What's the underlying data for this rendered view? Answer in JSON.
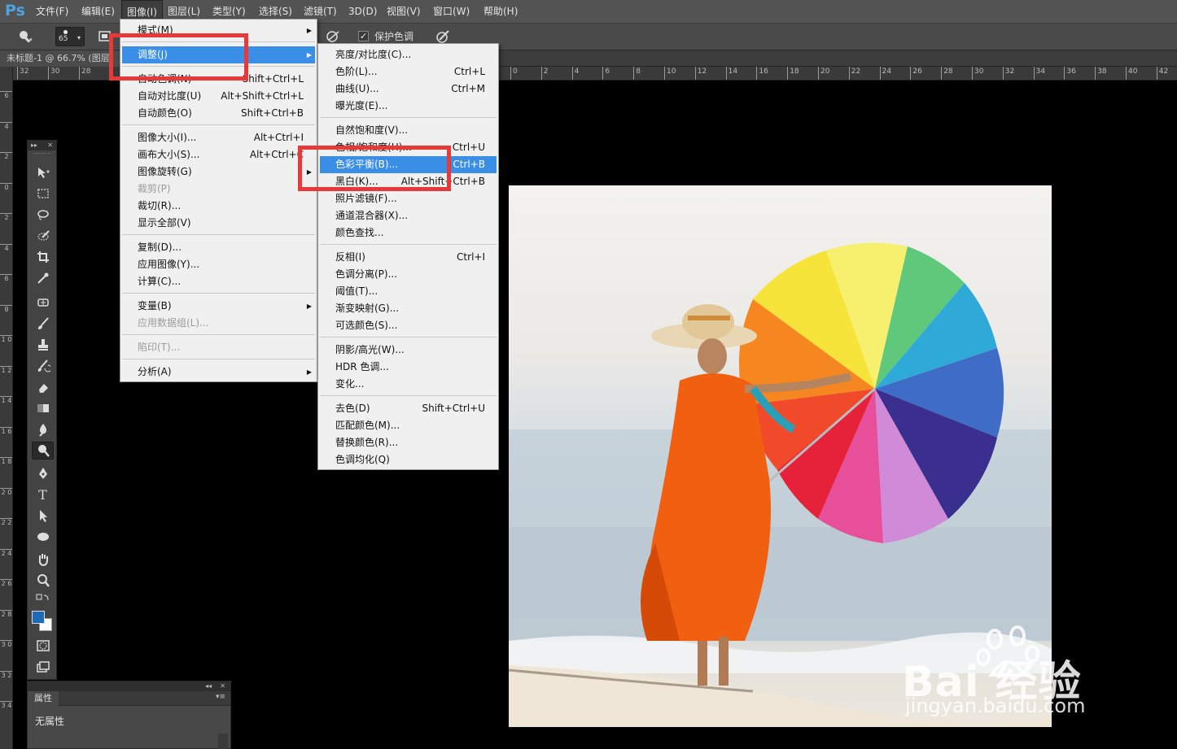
{
  "app": {
    "logo": "Ps"
  },
  "menubar": {
    "items": [
      "文件(F)",
      "编辑(E)",
      "图像(I)",
      "图层(L)",
      "类型(Y)",
      "选择(S)",
      "滤镜(T)",
      "3D(D)",
      "视图(V)",
      "窗口(W)",
      "帮助(H)"
    ],
    "active": "图像(I)"
  },
  "options": {
    "brush_size": "65",
    "protect_tone_label": "保护色调",
    "protect_tone_checked": "✓"
  },
  "document": {
    "tab_title": "未标题-1 @ 66.7% (图层"
  },
  "ruler": {
    "left_labels": [
      "32",
      "30",
      "28"
    ],
    "right_labels": [
      "0",
      "2",
      "4",
      "6",
      "8",
      "10",
      "12",
      "14",
      "16",
      "18",
      "20",
      "22",
      "24",
      "26",
      "28",
      "30",
      "32",
      "34",
      "36",
      "38",
      "40",
      "42"
    ],
    "v_labels": [
      "6",
      "4",
      "2",
      "0",
      "2",
      "4",
      "6",
      "8",
      "1 0",
      "1 2",
      "1 4",
      "1 6",
      "1 8",
      "2 0",
      "2 2",
      "2 4",
      "2 6",
      "2 8",
      "3 0",
      "3 2",
      "3 4"
    ]
  },
  "image_menu": {
    "items": [
      {
        "label": "模式(M)",
        "shortcut": "",
        "arrow": true,
        "disabled": false
      },
      {
        "sep": true
      },
      {
        "label": "调整(J)",
        "shortcut": "",
        "arrow": true,
        "disabled": false,
        "highlight": true
      },
      {
        "sep": true
      },
      {
        "label": "自动色调(N)",
        "shortcut": "Shift+Ctrl+L",
        "arrow": false,
        "disabled": false
      },
      {
        "label": "自动对比度(U)",
        "shortcut": "Alt+Shift+Ctrl+L",
        "arrow": false,
        "disabled": false
      },
      {
        "label": "自动颜色(O)",
        "shortcut": "Shift+Ctrl+B",
        "arrow": false,
        "disabled": false
      },
      {
        "sep": true
      },
      {
        "label": "图像大小(I)...",
        "shortcut": "Alt+Ctrl+I",
        "arrow": false,
        "disabled": false
      },
      {
        "label": "画布大小(S)...",
        "shortcut": "Alt+Ctrl+C",
        "arrow": false,
        "disabled": false
      },
      {
        "label": "图像旋转(G)",
        "shortcut": "",
        "arrow": true,
        "disabled": false
      },
      {
        "label": "裁剪(P)",
        "shortcut": "",
        "arrow": false,
        "disabled": true
      },
      {
        "label": "裁切(R)...",
        "shortcut": "",
        "arrow": false,
        "disabled": false
      },
      {
        "label": "显示全部(V)",
        "shortcut": "",
        "arrow": false,
        "disabled": false
      },
      {
        "sep": true
      },
      {
        "label": "复制(D)...",
        "shortcut": "",
        "arrow": false,
        "disabled": false
      },
      {
        "label": "应用图像(Y)...",
        "shortcut": "",
        "arrow": false,
        "disabled": false
      },
      {
        "label": "计算(C)...",
        "shortcut": "",
        "arrow": false,
        "disabled": false
      },
      {
        "sep": true
      },
      {
        "label": "变量(B)",
        "shortcut": "",
        "arrow": true,
        "disabled": false
      },
      {
        "label": "应用数据组(L)...",
        "shortcut": "",
        "arrow": false,
        "disabled": true
      },
      {
        "sep": true
      },
      {
        "label": "陷印(T)...",
        "shortcut": "",
        "arrow": false,
        "disabled": true
      },
      {
        "sep": true
      },
      {
        "label": "分析(A)",
        "shortcut": "",
        "arrow": true,
        "disabled": false
      }
    ]
  },
  "adjust_menu": {
    "items": [
      {
        "label": "亮度/对比度(C)...",
        "shortcut": ""
      },
      {
        "label": "色阶(L)...",
        "shortcut": "Ctrl+L"
      },
      {
        "label": "曲线(U)...",
        "shortcut": "Ctrl+M"
      },
      {
        "label": "曝光度(E)...",
        "shortcut": ""
      },
      {
        "sep": true
      },
      {
        "label": "自然饱和度(V)...",
        "shortcut": ""
      },
      {
        "label": "色相/饱和度(H)...",
        "shortcut": "Ctrl+U"
      },
      {
        "label": "色彩平衡(B)...",
        "shortcut": "Ctrl+B",
        "highlight": true
      },
      {
        "label": "黑白(K)...",
        "shortcut": "Alt+Shift+Ctrl+B"
      },
      {
        "label": "照片滤镜(F)...",
        "shortcut": ""
      },
      {
        "label": "通道混合器(X)...",
        "shortcut": ""
      },
      {
        "label": "颜色查找...",
        "shortcut": ""
      },
      {
        "sep": true
      },
      {
        "label": "反相(I)",
        "shortcut": "Ctrl+I"
      },
      {
        "label": "色调分离(P)...",
        "shortcut": ""
      },
      {
        "label": "阈值(T)...",
        "shortcut": ""
      },
      {
        "label": "渐变映射(G)...",
        "shortcut": ""
      },
      {
        "label": "可选颜色(S)...",
        "shortcut": ""
      },
      {
        "sep": true
      },
      {
        "label": "阴影/高光(W)...",
        "shortcut": ""
      },
      {
        "label": "HDR 色调...",
        "shortcut": ""
      },
      {
        "label": "变化...",
        "shortcut": ""
      },
      {
        "sep": true
      },
      {
        "label": "去色(D)",
        "shortcut": "Shift+Ctrl+U"
      },
      {
        "label": "匹配颜色(M)...",
        "shortcut": ""
      },
      {
        "label": "替换颜色(R)...",
        "shortcut": ""
      },
      {
        "label": "色调均化(Q)",
        "shortcut": ""
      }
    ]
  },
  "properties_panel": {
    "tab": "属性",
    "content": "无属性",
    "collapse": "◂◂",
    "close": "✕",
    "menu": "▾≡"
  },
  "toolbox": {
    "head_left": "▸▸",
    "head_right": "✕",
    "tools": [
      "move-tool",
      "marquee-tool",
      "lasso-tool",
      "quick-select-tool",
      "crop-tool",
      "eyedropper-tool",
      "healing-brush-tool",
      "brush-tool",
      "clone-stamp-tool",
      "history-brush-tool",
      "eraser-tool",
      "gradient-tool",
      "blur-tool",
      "dodge-tool",
      "pen-tool",
      "type-tool",
      "path-select-tool",
      "ellipse-tool",
      "hand-tool",
      "zoom-tool"
    ],
    "type_glyph": "T",
    "active_tool": "dodge-tool"
  },
  "colors": {
    "foreground": "#1e6ab4",
    "background": "#ffffff",
    "menu_highlight": "#3a8ee6",
    "annotation_red": "#e8393a"
  },
  "watermark": {
    "brand": "Bai 经验",
    "url": "jingyan.baidu.com"
  }
}
